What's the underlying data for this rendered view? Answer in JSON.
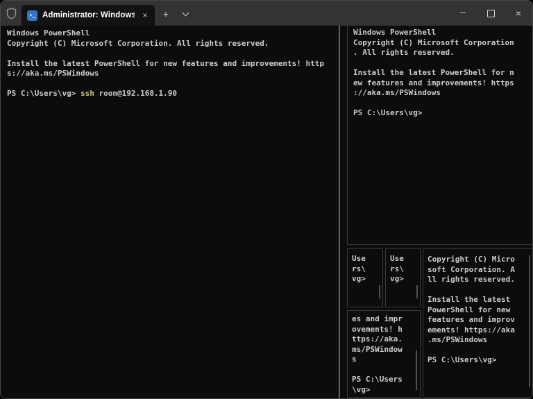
{
  "titlebar": {
    "tab": {
      "title": "Administrator: Windows PowerShell",
      "icon_glyph": ">_",
      "close_glyph": "×"
    },
    "new_tab_glyph": "+",
    "minimize_glyph": "–",
    "close_glyph": "×"
  },
  "panes": {
    "left": {
      "lines": [
        "Windows PowerShell",
        "Copyright (C) Microsoft Corporation. All rights reserved.",
        "",
        "Install the latest PowerShell for new features and improvements! http",
        "s://aka.ms/PSWindows",
        ""
      ],
      "prompt": "PS C:\\Users\\vg> ",
      "command": "ssh",
      "command_args": " roon@192.168.1.90"
    },
    "top_right": {
      "lines": [
        "Windows PowerShell",
        "Copyright (C) Microsoft Corporation",
        ". All rights reserved.",
        "",
        "Install the latest PowerShell for n",
        "ew features and improvements! https",
        "://aka.ms/PSWindows",
        "",
        "PS C:\\Users\\vg>"
      ]
    },
    "small_1": {
      "lines": [
        "Use",
        "rs\\",
        "vg>"
      ]
    },
    "small_2": {
      "lines": [
        "Use",
        "rs\\",
        "vg>"
      ]
    },
    "bottom_middle": {
      "lines": [
        "es and impr",
        "ovements! h",
        "ttps://aka.",
        "ms/PSWindow",
        "s",
        "",
        "PS C:\\Users",
        "\\vg>"
      ]
    },
    "bottom_right": {
      "lines": [
        "Copyright (C) Micro",
        "soft Corporation. A",
        "ll rights reserved.",
        "",
        "Install the latest",
        "PowerShell for new",
        "features and improv",
        "ements! https://aka",
        ".ms/PSWindows",
        "",
        "PS C:\\Users\\vg>"
      ]
    }
  },
  "colors": {
    "bg": "#0c0c0c",
    "fg": "#cccccc",
    "titlebar-bg": "#333333",
    "tab-bg": "#121212",
    "pane-border": "#3a3a3a",
    "focus-border": "#6b6149",
    "command": "#c9c87a",
    "scrollbar": "#4f4f4f",
    "window-border": "#454545"
  }
}
